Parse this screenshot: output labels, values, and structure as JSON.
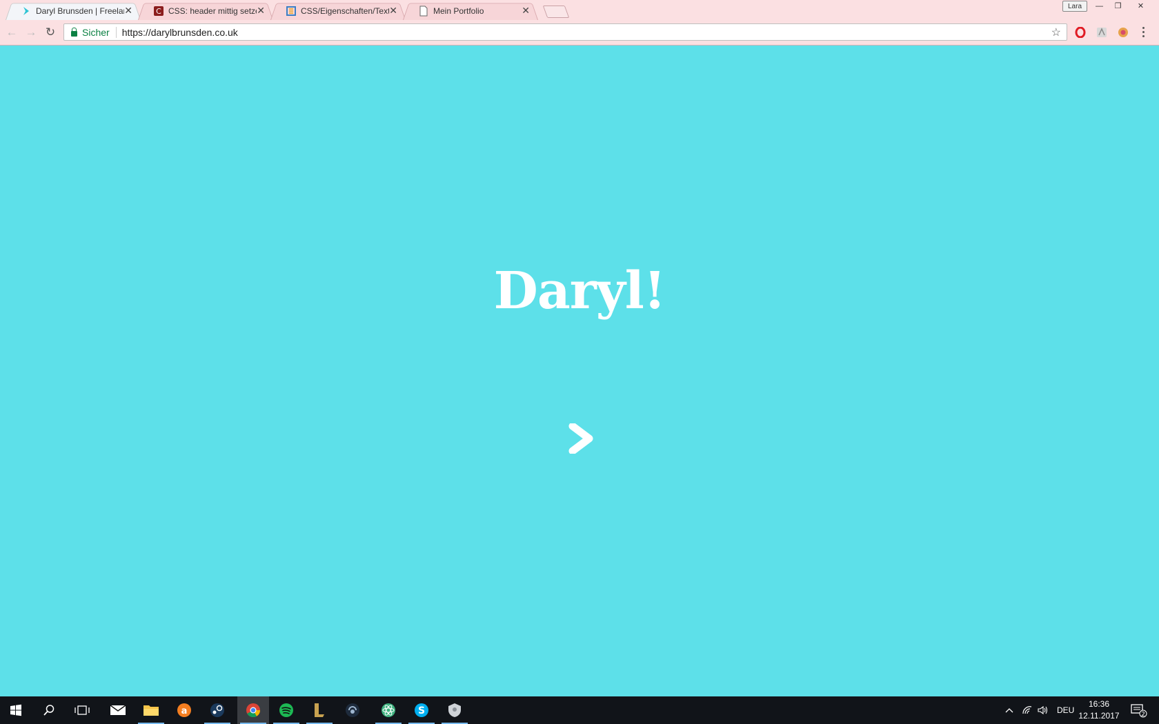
{
  "browser": {
    "tabs": [
      {
        "title": "Daryl Brunsden | Freelan",
        "active": true,
        "favicon": "chevron-favicon"
      },
      {
        "title": "CSS: header mittig setzen",
        "active": false,
        "favicon": "red-c-favicon"
      },
      {
        "title": "CSS/Eigenschaften/Texta",
        "active": false,
        "favicon": "selfhtml-favicon"
      },
      {
        "title": "Mein Portfolio",
        "active": false,
        "favicon": "document-favicon"
      }
    ],
    "close_glyph": "✕",
    "user_badge": "Lara",
    "window_controls": {
      "minimize": "—",
      "restore": "❐",
      "close": "✕"
    },
    "nav": {
      "back": "←",
      "forward": "→",
      "reload": "↻"
    },
    "address": {
      "secure_label": "Sicher",
      "url": "https://darylbrunsden.co.uk",
      "bookmark_glyph": "☆"
    },
    "extensions": [
      "opera-icon",
      "acrobat-icon",
      "extension-icon"
    ]
  },
  "page": {
    "background": "#5de0e9",
    "headline": "Daryl!",
    "next_arrow": "chevron-right-icon"
  },
  "taskbar": {
    "apps": [
      "windows-start-icon",
      "search-icon",
      "task-view-icon",
      "mail-icon",
      "file-explorer-icon",
      "avast-icon",
      "steam-icon",
      "chrome-icon",
      "spotify-icon",
      "league-of-legends-icon",
      "teamspeak-icon",
      "atom-icon",
      "skype-icon",
      "vpn-icon"
    ],
    "language": "DEU",
    "time": "16:36",
    "date": "12.11.2017",
    "notification_count": "2"
  }
}
